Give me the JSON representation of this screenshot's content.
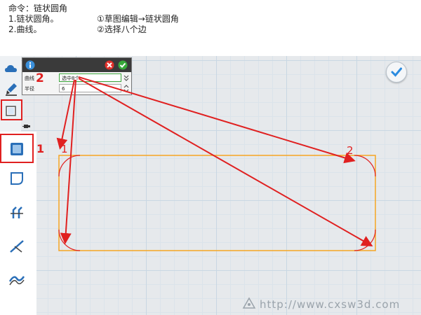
{
  "caption": {
    "title": "命令：链状圆角",
    "step1": "1.链状圆角。",
    "step2": "2.曲线。",
    "path": "①草图编辑→链状圆角",
    "select": "②选择八个边"
  },
  "dialog": {
    "curve_label": "曲线",
    "curve_value": "选中8个",
    "radius_label": "半径",
    "radius_value": "6"
  },
  "annotations": {
    "step1_marker": "1",
    "step2_marker": "2",
    "corner_1": "1",
    "corner_2": "2"
  },
  "watermark": "http://www.cxsw3d.com",
  "colors": {
    "highlight": "#e02020",
    "sketch": "#f5a623",
    "ok": "#2a8be0"
  },
  "icons": {
    "dialog_info": "info-icon",
    "dialog_cancel": "cancel-icon",
    "dialog_ok": "confirm-icon",
    "viewport_ok": "checkmark-icon"
  }
}
